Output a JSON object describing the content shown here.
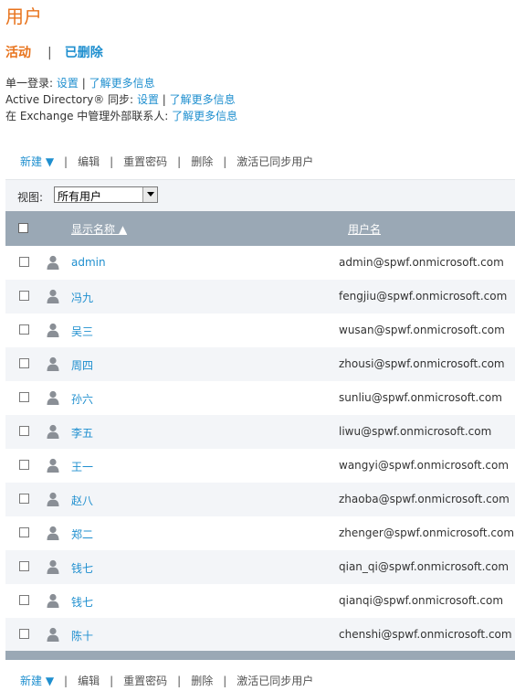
{
  "page": {
    "title": "用户"
  },
  "tabs": {
    "active": "活动",
    "separator": "|",
    "deleted": "已删除"
  },
  "info": {
    "sso_label": "单一登录:",
    "sso_setup": "设置",
    "sso_sep": "|",
    "sso_learn": "了解更多信息",
    "ad_label": "Active Directory® 同步:",
    "ad_setup": "设置",
    "ad_sep": "|",
    "ad_learn": "了解更多信息",
    "exchange_label": "在 Exchange 中管理外部联系人:",
    "exchange_learn": "了解更多信息"
  },
  "toolbar": {
    "new": "新建 ▼",
    "sep": "|",
    "edit": "编辑",
    "reset_password": "重置密码",
    "delete": "删除",
    "activate": "激活已同步用户"
  },
  "view": {
    "label": "视图:",
    "selected": "所有用户"
  },
  "table": {
    "columns": {
      "display_name": "显示名称 ▲",
      "user_name": "用户名"
    },
    "rows": [
      {
        "name": "admin",
        "email": "admin@spwf.onmicrosoft.com"
      },
      {
        "name": "冯九",
        "email": "fengjiu@spwf.onmicrosoft.com"
      },
      {
        "name": "吴三",
        "email": "wusan@spwf.onmicrosoft.com"
      },
      {
        "name": "周四",
        "email": "zhousi@spwf.onmicrosoft.com"
      },
      {
        "name": "孙六",
        "email": "sunliu@spwf.onmicrosoft.com"
      },
      {
        "name": "李五",
        "email": "liwu@spwf.onmicrosoft.com"
      },
      {
        "name": "王一",
        "email": "wangyi@spwf.onmicrosoft.com"
      },
      {
        "name": "赵八",
        "email": "zhaoba@spwf.onmicrosoft.com"
      },
      {
        "name": "郑二",
        "email": "zhenger@spwf.onmicrosoft.com"
      },
      {
        "name": "钱七",
        "email": "qian_qi@spwf.onmicrosoft.com"
      },
      {
        "name": "钱七",
        "email": "qianqi@spwf.onmicrosoft.com"
      },
      {
        "name": "陈十",
        "email": "chenshi@spwf.onmicrosoft.com"
      }
    ]
  },
  "icons": {
    "user": "user-icon",
    "dropdown": "dropdown-arrow-icon"
  },
  "colors": {
    "title": "#e8731c",
    "link": "#1f8fcf",
    "header": "#9aa8b5",
    "row_alt": "#f3f5f8"
  }
}
